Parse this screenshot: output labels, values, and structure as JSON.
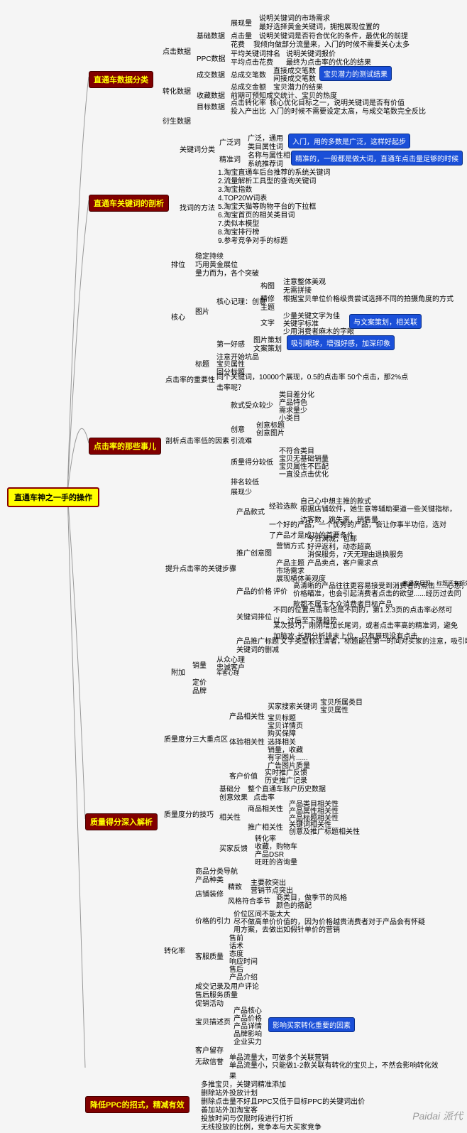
{
  "root": "直通车神之一手的操作",
  "watermark": "Paidai 派代",
  "s1": {
    "title": "直通车数据分类",
    "click": "点击数据",
    "jichu": "基础数据",
    "zhanxian": "展现量",
    "zx1": "说明关键词的市场需求",
    "zx2": "最好选择黄金关键词，拥抱展现位置的",
    "dianji": "点击量",
    "dj1": "说明关键词是否符合优化的条件，最优化的前提",
    "huafei": "花费",
    "hf1": "我倾向做部分流量来，入门的时候不需要关心太多",
    "ppc": "PPC数据",
    "pj1": "平均关键词排名",
    "pj1d": "说明关键词报价",
    "pj2": "平均点击花费",
    "pj2d": "最终为点击率的优化的结果",
    "zhuanhua": "转化数据",
    "cj": "成交数据",
    "zcj": "总成交笔数",
    "zc1": "直接成交笔数",
    "zc2": "间接成交笔数",
    "bbt": "宝贝潜力的测试结果",
    "zcje": "总成交金额",
    "zcjed": "宝贝潜力的结果",
    "sc": "收藏数据",
    "scd": "前期可预知成交统计、宝贝的热度",
    "mb": "目标数据",
    "mbd1": "点击转化率",
    "mbd1d": "核心优化目标之一，说明关键词是否有价值",
    "mbd2": "投入产出比",
    "mbd2d": "入门的时候不需要设定太高，与成交笔数完全反比",
    "yansheng": "衍生数据"
  },
  "s2": {
    "title": "直通车关键词的剖析",
    "fenlei": "关键词分类",
    "guangfa": "广泛词",
    "gf1": "广泛，通用",
    "gf2": "类目属性词",
    "gfinfo": "入门，用的多数是广泛，这样好起步",
    "jingzhun": "精准词",
    "jz1": "名称与属性相合",
    "jz2": "系统推荐词",
    "jzinfo": "精准的，一般都是做大词，直通车点击量足够的时候",
    "fangfa": "找词的方法",
    "f1": "1.淘宝直通车后台推荐的系统关键词",
    "f2": "2.流量解析工具型的查询关键词",
    "f3": "3.淘宝指数",
    "f4": "4.TOP20W词表",
    "f5": "5.淘宝天猫等购物平台的下拉框",
    "f6": "6.淘宝首页的相关类目词",
    "f7": "7.类似本模型",
    "f8": "8.淘宝排行榜",
    "f9": "9.参考竞争对手的标题"
  },
  "s3": {
    "title": "点击率的那些事儿",
    "paiwei": "排位",
    "pw1": "稳定持续",
    "pw2": "巧用黄金展位",
    "pw3": "量力而为，各个突破",
    "hexin": "核心",
    "tupian": "图片",
    "gt": "构图",
    "gt1": "注意整体美观",
    "gt2": "无需拼接",
    "jx": "核心记理：创意",
    "jx1": "精修",
    "jx1d": "根据宝贝单位价格级贵尝试选择不同的拍摄角度的方式",
    "jx2": "主题",
    "wz": "文字",
    "wz1": "少量关键文字为佳",
    "wz2": "关键字标准",
    "wz3": "少用消费者麻木的字眼",
    "wzinfo": "与文案策划，相关联",
    "dyhg": "第一好感",
    "dy1": "图片策划",
    "dy2": "文案策划",
    "dyinfo": "吸引眼球，增强好感，加深印象",
    "zy": "注意开始坑品",
    "bt": "标题",
    "btd": "宝贝属性",
    "btd2": "回分标题",
    "zhongyao": "点击率的重要性",
    "zyd": "同个关键词，10000个展现，0.5的点击率 50个点击，那2%点击率呢？",
    "pouxi": "剖析点击率低的因素",
    "ksshou": "款式受众较少",
    "ks1": "类目差分化",
    "ks2": "产品特色",
    "ks3": "需求量少",
    "ks4": "小类目",
    "cy": "创意",
    "cy1": "创意标题",
    "cy2": "创意图片",
    "yld": "引流难",
    "zldji": "质量得分较低",
    "zd1": "不符合类目",
    "zd2": "宝贝无基础销量",
    "zd3": "宝贝属性不匹配",
    "zd4": "一直没点击优化",
    "pmjd": "排名较低",
    "zxs": "展现少",
    "tisheng": "提升点击率的关键步骤",
    "cpks": "产品款式",
    "tyxq": "经验选款",
    "ty1": "自己心中想主推的款式",
    "ty2": "根据店铺软件，她生意等辅助渠道一些关键指标，访客数，跳失率，销售量...",
    "yh": "一个好的产品，一个优秀的产品，会让你事半功倍，选对了产品才是成功的首要条件",
    "tgcy": "推广创意图",
    "yxfs": "营销方式",
    "yx1": "今日满减，包邮",
    "yx2": "好评返利，动态超高",
    "yx3": "消保服务，7天无理由退换服务",
    "cpmd": "产品主题",
    "cpmd1": "产品卖点，客户需求点",
    "sc": "市场需求",
    "mt": "展现横体美观度",
    "cpjq": "产品的价格",
    "pj": "评价",
    "pj1": "高清晰的产品往往更容易接受到消费者的点击......心态，视觉冲击",
    "pj2": "价格瞄准，也会引起消费者点击的欲望......经历过去同款都不属于大众消费者目标产品",
    "pjside": "直通车展现，标题还有额外的",
    "gjcpw": "关键词排位",
    "gp1": "不同的位置点击率也是不同的，第1.2.3页的点击率必然可以，过后至下降趋势",
    "gp2": "某次技巧，刚刚增加长尾词，或者点击率高的精准词，避免加脑攻-长期分析排末上位，只有展现没有点击",
    "cptg": "产品推广标题",
    "cptgd": "文字类型标注清者，标题能在第一时间对买家的注意，吸引眼球",
    "gjcsj": "关键词的删减",
    "fj": "附加",
    "xiaoliang": "销量",
    "xl1": "从众心理",
    "xl2": "忠诚客户",
    "xl3": "车客心理",
    "dj": "定价",
    "pp": "品牌"
  },
  "s4": {
    "title": "质量得分深入解析",
    "sanda": "质量度分三大重点区",
    "cpxgx": "产品相关性",
    "cpx1": "买家搜索关键词",
    "cpx1a": "宝贝所属类目",
    "cpx1b": "宝贝属性",
    "cpx2": "宝贝标题",
    "cpx3": "宝贝详情页",
    "cpx4": "购买保障",
    "txgx": "体验相关性",
    "tx1": "选择相关",
    "tx2": "销量，收藏",
    "tx3": "有字图片......",
    "tx4": "广告图片质量",
    "khjz": "客户价值",
    "kh1": "实时推广反馈",
    "kh2": "历史推广记录",
    "jiqiao": "质量度分的技巧",
    "jcf": "基础分",
    "jcfd": "整个直通车账户历史数据",
    "cyxg": "创意效果",
    "cyxgd": "点击率",
    "xgx": "相关性",
    "spxg": "商品相关性",
    "sp1": "产品类目相关性",
    "sp2": "产品属性相关性",
    "sp3": "产品标题相关性",
    "tgxg": "推广相关性",
    "tg1": "关键词相关性",
    "tg2": "创意及推广标题相关性",
    "mjfk": "买家反馈",
    "mf1": "转化率",
    "mf2": "收藏，购物车",
    "mf3": "产品DSR",
    "mf4": "旺旺的咨询量",
    "zhlv": "转化率",
    "spfl": "商品分类导航",
    "cpzl": "产品种类",
    "dpzx": "店铺装修",
    "jk": "精致",
    "jk1": "主要款突出",
    "jk2": "营销节点突出",
    "fg": "风格符合季节",
    "fg1": "商类目，做季节的风格",
    "fg2": "颜色的搭配",
    "jgxy": "价格的引力",
    "jy1": "价位区间不能太大",
    "jy2": "尽不做高单价价值的，因为价格越贵消费者对于产品会有怀疑",
    "jy3": "用方案，去做出如假针单价的营销",
    "kfzl": "客服质量",
    "kf1": "售前",
    "kf2": "话术",
    "kf3": "态度",
    "kf4": "响应时间",
    "kf5": "售后",
    "kf6": "产品介绍",
    "cjjl": "成交记录及用户评论",
    "shfw": "售后服务质量",
    "cxhd": "促销活动",
    "bbms": "宝贝描述页",
    "bb1": "产品核心",
    "bb2": "产品价格",
    "bb3": "产品详情",
    "bb4": "品牌影响",
    "bb5": "企业实力",
    "bbinfo": "影响买家转化重要的因素",
    "khlz": "客户留存",
    "wjxz": "无敌信誉",
    "wj1": "单品流量大，可做多个关联营销",
    "wj2": "单品流量小，只能做1-2款关联有转化的宝贝上，不然会影响转化效果"
  },
  "s5": {
    "title": "降低PPC的招式，精减有效",
    "t1": "多推宝贝，关键词精准添加",
    "t2": "删除站外投放计划",
    "t3": "删除点击量不好且PPC又低于目标PPC的关键词出价",
    "t4": "善加站外加淘宝客",
    "t5": "投放时间与仅限时段进行打折",
    "t6": "无线投放的比例，竞争本与大买家竞争"
  }
}
